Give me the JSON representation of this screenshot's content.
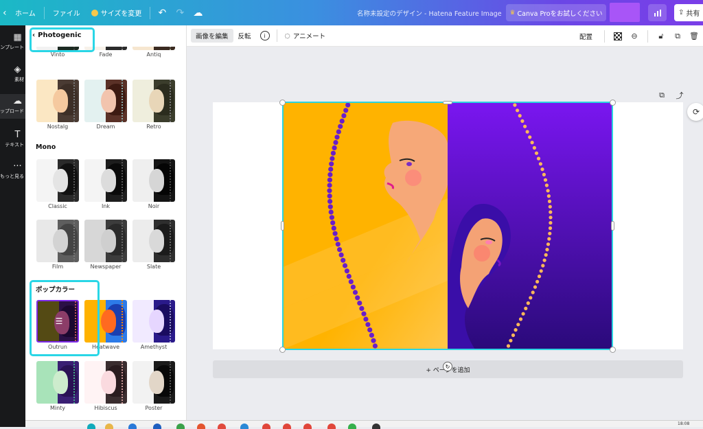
{
  "topbar": {
    "home_label": "ホーム",
    "file_label": "ファイル",
    "resize_label": "サイズを変更",
    "design_title": "名称未設定のデザイン - Hatena Feature Image",
    "pro_label": "Canva Proをお試しください",
    "share_label": "共有"
  },
  "rail": {
    "items": [
      {
        "label": "ンプレート",
        "icon": "template-icon"
      },
      {
        "label": "素材",
        "icon": "elements-icon"
      },
      {
        "label": "ップロード",
        "icon": "upload-icon"
      },
      {
        "label": "テキスト",
        "icon": "text-icon"
      },
      {
        "label": "もっと見る",
        "icon": "more-icon"
      }
    ]
  },
  "panel": {
    "back_label": "Photogenic",
    "sections": [
      {
        "title": ""
      },
      {
        "title": "Mono"
      },
      {
        "title": "ポップカラー"
      }
    ],
    "filters": [
      {
        "label": "Vinto",
        "c1": "#f2f2f2",
        "c2": "#1c2a22",
        "face": "#e9dcc8",
        "hair": "#0f1a14",
        "dot": "#444"
      },
      {
        "label": "Fade",
        "c1": "#f7f2ea",
        "c2": "#2b2b2b",
        "face": "#efe2d0",
        "hair": "#222",
        "dot": "#888"
      },
      {
        "label": "Antiq",
        "c1": "#f6e6cf",
        "c2": "#3a2a20",
        "face": "#f0d5b5",
        "hair": "#2a1c12",
        "dot": "#998"
      },
      {
        "label": "Nostalg",
        "c1": "#fbe7c3",
        "c2": "#4a3b33",
        "face": "#f5c99f",
        "hair": "#3d2f27",
        "dot": "#777"
      },
      {
        "label": "Dream",
        "c1": "#e3f1f0",
        "c2": "#5a3127",
        "face": "#f2c4ae",
        "hair": "#3d1a12",
        "dot": "#8aa"
      },
      {
        "label": "Retro",
        "c1": "#efeedd",
        "c2": "#3b3d2c",
        "face": "#e8d6b8",
        "hair": "#2b2c1e",
        "dot": "#777"
      },
      {
        "label": "Classic",
        "c1": "#f4f4f4",
        "c2": "#2a2a2a",
        "face": "#e4e4e4",
        "hair": "#111",
        "dot": "#555"
      },
      {
        "label": "Ink",
        "c1": "#f4f4f4",
        "c2": "#1d1d1d",
        "face": "#dcdcdc",
        "hair": "#0a0a0a",
        "dot": "#555"
      },
      {
        "label": "Noir",
        "c1": "#efefef",
        "c2": "#141414",
        "face": "#d6d6d6",
        "hair": "#050505",
        "dot": "#444"
      },
      {
        "label": "Film",
        "c1": "#e8e8e8",
        "c2": "#5e5e5e",
        "face": "#d3d3d3",
        "hair": "#444",
        "dot": "#777"
      },
      {
        "label": "Newspaper",
        "c1": "#d7d7d7",
        "c2": "#3c3c3c",
        "face": "#cfcfcf",
        "hair": "#2a2a2a",
        "dot": "#666"
      },
      {
        "label": "Slate",
        "c1": "#ececec",
        "c2": "#2e2e2e",
        "face": "#d9d9d9",
        "hair": "#1b1b1b",
        "dot": "#666"
      },
      {
        "label": "Outrun",
        "c1": "#544a14",
        "c2": "#2b1046",
        "face": "#8c3d68",
        "hair": "#1c0830",
        "dot": "#b55"
      },
      {
        "label": "Heatwave",
        "c1": "#ffb200",
        "c2": "#2d7be8",
        "face": "#ff6a20",
        "hair": "#1a3fb0",
        "dot": "#f80"
      },
      {
        "label": "Amethyst",
        "c1": "#f1eaff",
        "c2": "#2a1a8a",
        "face": "#e6d6ff",
        "hair": "#1a0c60",
        "dot": "#99c"
      },
      {
        "label": "Minty",
        "c1": "#a8e3b9",
        "c2": "#3a1f73",
        "face": "#cdeccd",
        "hair": "#2a1255",
        "dot": "#4a8"
      },
      {
        "label": "Hibiscus",
        "c1": "#fff3f4",
        "c2": "#3a2d2f",
        "face": "#fadadf",
        "hair": "#2a1c1f",
        "dot": "#c99"
      },
      {
        "label": "Poster",
        "c1": "#f2f2f2",
        "c2": "#1a1a1a",
        "face": "#e2d6c8",
        "hair": "#080808",
        "dot": "#555"
      }
    ]
  },
  "ctx": {
    "edit_label": "画像を編集",
    "flip_label": "反転",
    "animate_label": "アニメート",
    "arrange_label": "配置"
  },
  "canvas": {
    "add_page_label": "+ ページを追加",
    "left_bg": "#ffb300",
    "right_bg_top": "#7a16f0",
    "right_bg_bottom": "#2a0a7a",
    "accent": "#2ad3e0"
  },
  "taskbar": {
    "time": "18:08"
  }
}
